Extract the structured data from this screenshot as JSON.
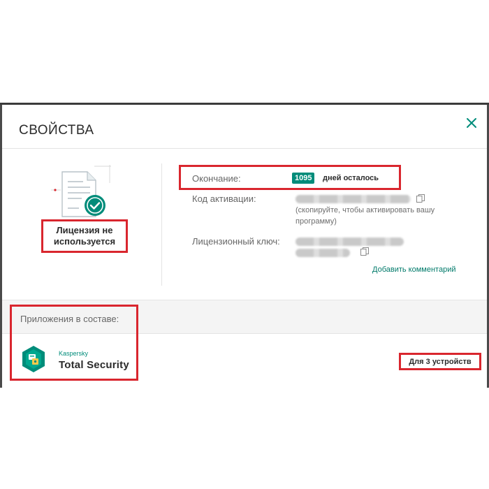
{
  "dialog": {
    "title": "СВОЙСТВА",
    "close_icon": "close-icon"
  },
  "license": {
    "status": "Лицензия не используется",
    "expiry_label": "Окончание:",
    "days_left": "1095",
    "days_left_text": "дней осталось",
    "activation_code_label": "Код активации:",
    "activation_hint": "(скопируйте, чтобы активировать вашу программу)",
    "license_key_label": "Лицензионный ключ:",
    "add_comment": "Добавить комментарий"
  },
  "apps": {
    "header": "Приложения в составе:",
    "items": [
      {
        "brand": "Kaspersky",
        "name": "Total Security",
        "devices": "Для 3 устройств"
      }
    ]
  },
  "colors": {
    "accent": "#008c7a",
    "highlight": "#d9262e"
  }
}
